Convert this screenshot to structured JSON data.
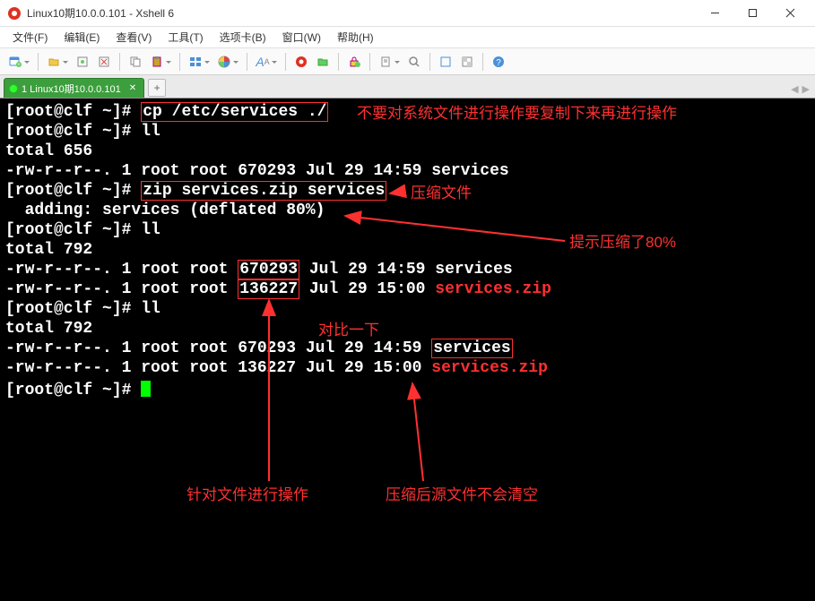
{
  "title": "Linux10期10.0.0.101 - Xshell 6",
  "menu": [
    "文件(F)",
    "编辑(E)",
    "查看(V)",
    "工具(T)",
    "选项卡(B)",
    "窗口(W)",
    "帮助(H)"
  ],
  "tab_label": "1 Linux10期10.0.0.101",
  "term": {
    "p": "[root@clf ~]# ",
    "cmd1": "cp /etc/services ./",
    "cmd2": "ll",
    "tot1": "total 656",
    "l1": "-rw-r--r--. 1 root root 670293 Jul 29 14:59 services",
    "cmd3": "zip services.zip services",
    "add": "  adding: services (deflated 80%)",
    "tot2": "total 792",
    "l2": "-rw-r--r--. 1 root root ",
    "sz1": "670293",
    "rest2": " Jul 29 14:59 services",
    "sz2": "136227",
    "rest3": " Jul 29 15:00 ",
    "zip": "services.zip",
    "l4": "-rw-r--r--. 1 root root 670293 Jul 29 14:59 ",
    "svc": "services",
    "l5": "-rw-r--r--. 1 root root 136227 Jul 29 15:00 "
  },
  "ann": {
    "a1": "不要对系统文件进行操作要复制下来再进行操作",
    "a2": "压缩文件",
    "a3": "提示压缩了80%",
    "a4": "对比一下",
    "a5": "针对文件进行操作",
    "a6": "压缩后源文件不会清空"
  }
}
